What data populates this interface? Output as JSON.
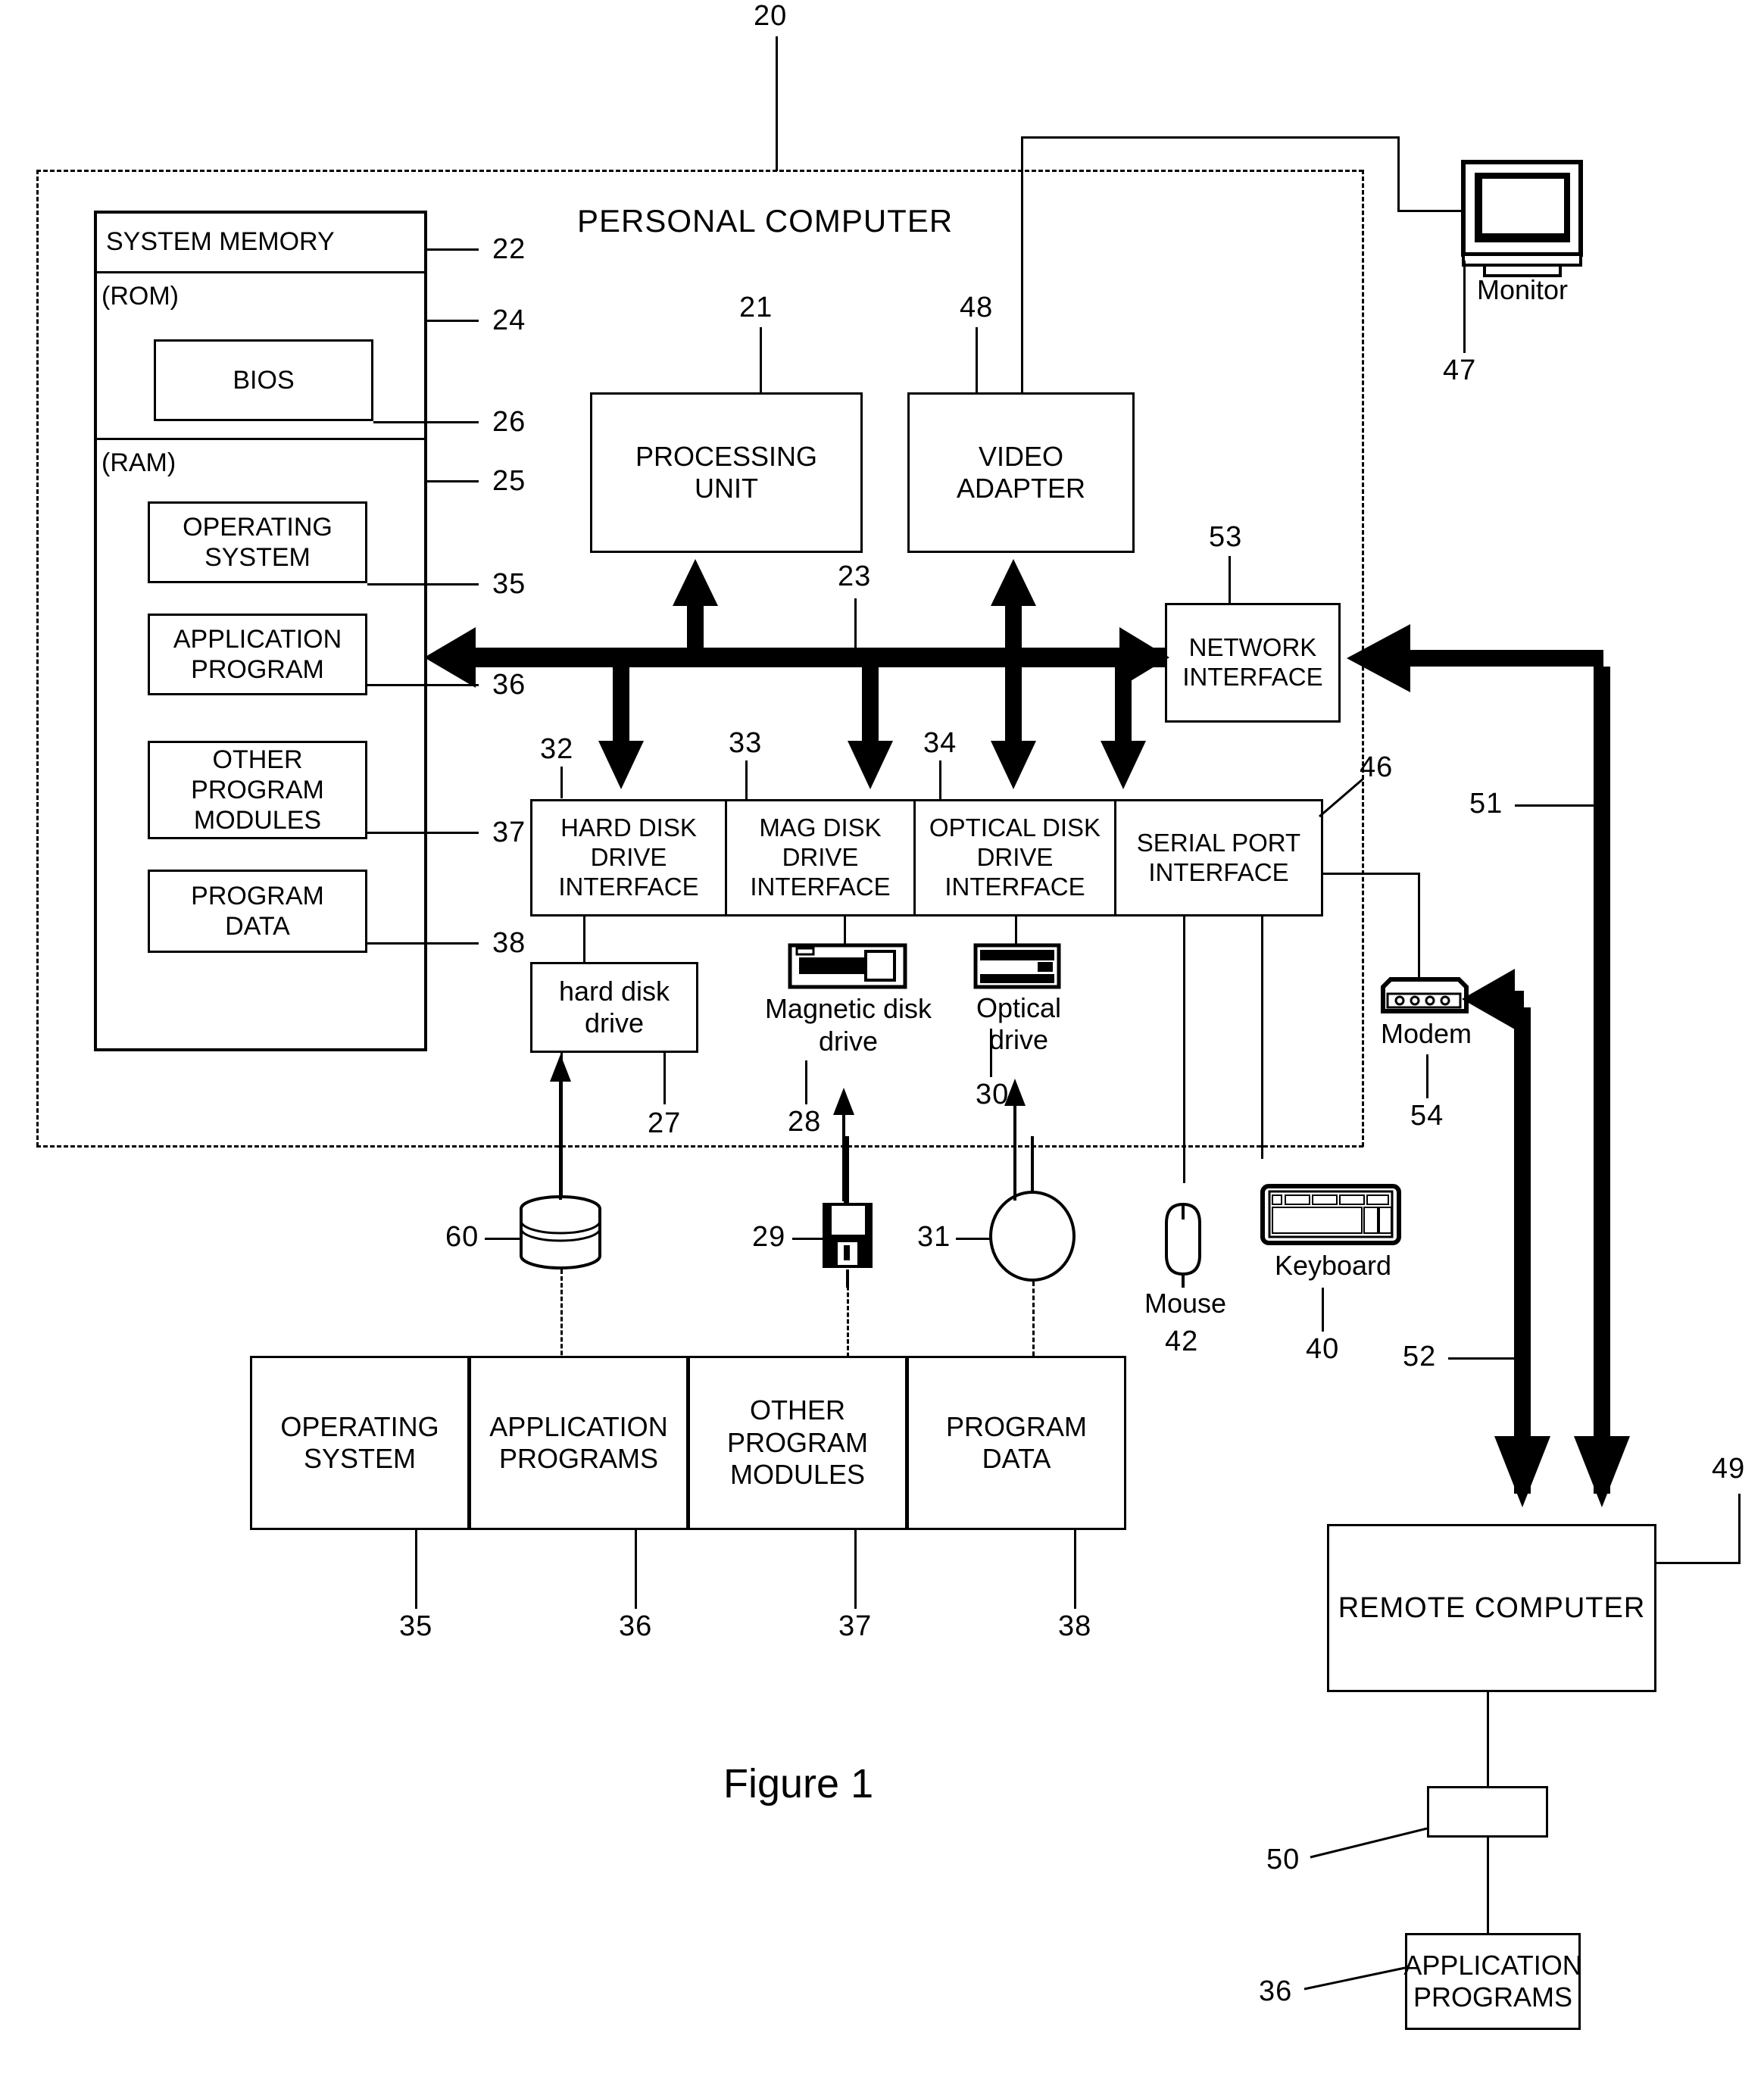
{
  "figure": {
    "caption": "Figure 1",
    "system_label": "PERSONAL COMPUTER",
    "system_ref": "20"
  },
  "memory": {
    "title": "SYSTEM MEMORY",
    "title_ref": "22",
    "rom_label": "(ROM)",
    "rom_ref": "24",
    "bios_label": "BIOS",
    "bios_ref": "26",
    "ram_label": "(RAM)",
    "ram_ref": "25",
    "items": [
      {
        "label": "OPERATING\nSYSTEM",
        "ref": "35"
      },
      {
        "label": "APPLICATION\nPROGRAM",
        "ref": "36"
      },
      {
        "label": "OTHER\nPROGRAM\nMODULES",
        "ref": "37"
      },
      {
        "label": "PROGRAM\nDATA",
        "ref": "38"
      }
    ]
  },
  "core": {
    "processing_unit": {
      "label": "PROCESSING\nUNIT",
      "ref": "21"
    },
    "video_adapter": {
      "label": "VIDEO\nADAPTER",
      "ref": "48"
    },
    "network_interface": {
      "label": "NETWORK\nINTERFACE",
      "ref": "53"
    },
    "bus_ref": "23"
  },
  "interfaces": [
    {
      "label": "HARD DISK\nDRIVE\nINTERFACE",
      "ref": "32"
    },
    {
      "label": "MAG DISK\nDRIVE\nINTERFACE",
      "ref": "33"
    },
    {
      "label": "OPTICAL DISK\nDRIVE\nINTERFACE",
      "ref": "34"
    },
    {
      "label": "SERIAL PORT\nINTERFACE",
      "ref": "46"
    }
  ],
  "drives": {
    "hard_disk_drive": {
      "label": "hard disk\ndrive",
      "ref": "27"
    },
    "magnetic_disk_drive": {
      "label": "Magnetic disk\ndrive",
      "ref": "28"
    },
    "optical_drive": {
      "label": "Optical drive",
      "ref": "30"
    }
  },
  "media": {
    "hard_disk": {
      "ref": "60"
    },
    "floppy_disk": {
      "ref": "29"
    },
    "optical_disc": {
      "ref": "31"
    }
  },
  "peripherals": {
    "monitor": {
      "label": "Monitor",
      "ref": "47"
    },
    "mouse": {
      "label": "Mouse",
      "ref": "42"
    },
    "keyboard": {
      "label": "Keyboard",
      "ref": "40"
    },
    "modem": {
      "label": "Modem",
      "ref": "54"
    }
  },
  "storage_contents": [
    {
      "label": "OPERATING\nSYSTEM",
      "ref": "35"
    },
    {
      "label": "APPLICATION\nPROGRAMS",
      "ref": "36"
    },
    {
      "label": "OTHER\nPROGRAM\nMODULES",
      "ref": "37"
    },
    {
      "label": "PROGRAM\nDATA",
      "ref": "38"
    }
  ],
  "remote": {
    "computer": {
      "label": "REMOTE COMPUTER",
      "ref": "49"
    },
    "memory_ref": "50",
    "application_programs": {
      "label": "APPLICATION\nPROGRAMS",
      "ref": "36"
    }
  },
  "links": {
    "wan_ref": "51",
    "lan_ref": "52"
  }
}
